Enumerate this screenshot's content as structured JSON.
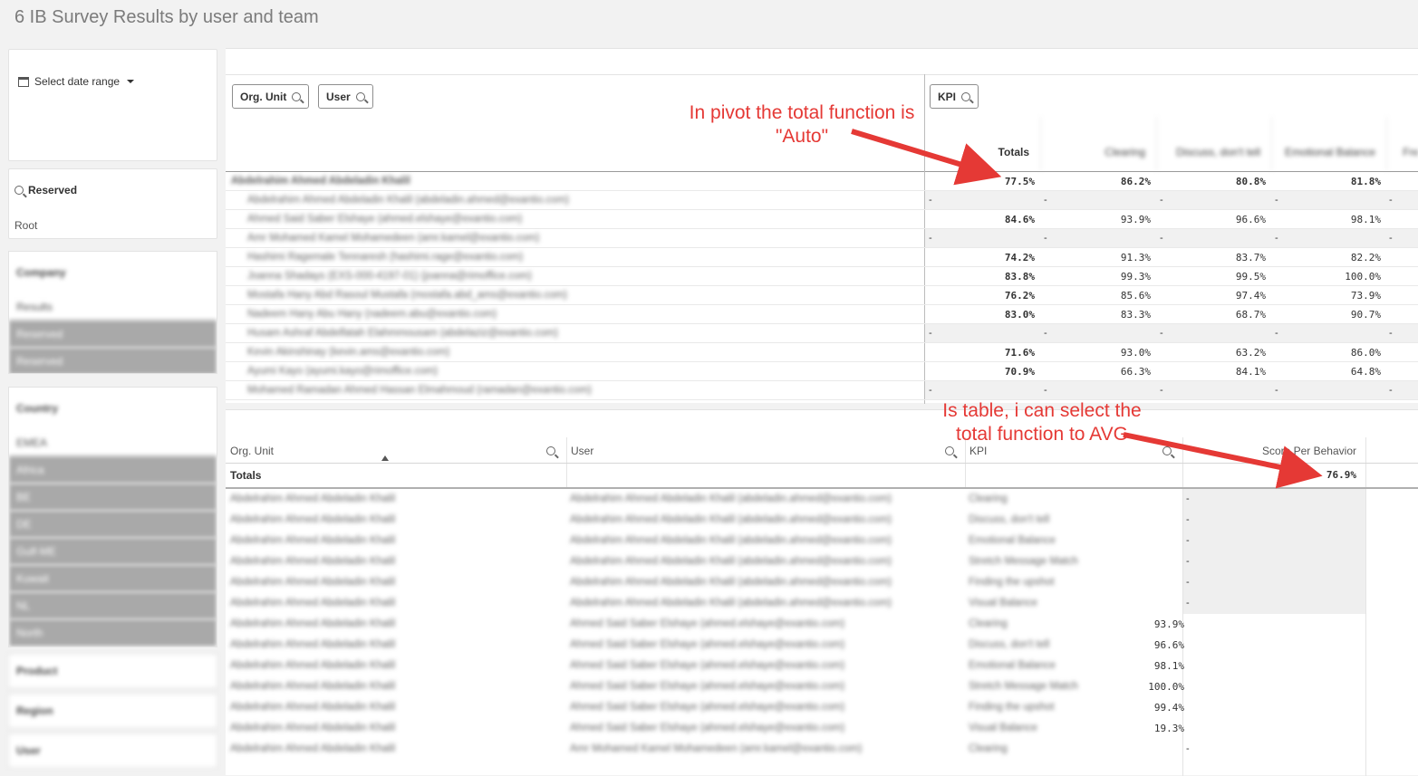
{
  "page": {
    "title": "6 IB Survey Results by user and team"
  },
  "date_filter": {
    "label": "Select date range"
  },
  "reserved": {
    "title": "Reserved",
    "value": "Root"
  },
  "lists": {
    "company": {
      "title": "Company",
      "items": [
        "Results",
        "Reserved",
        "Reserved"
      ]
    },
    "country": {
      "title": "Country",
      "items": [
        "EMEA",
        "Africa",
        "BE",
        "DE",
        "Gulf-ME",
        "Kuwait",
        "NL",
        "North"
      ]
    },
    "product": "Product",
    "region": "Region",
    "user": "User"
  },
  "pivot": {
    "dims": [
      "Org. Unit",
      "User"
    ],
    "col_dim": "KPI",
    "headers": [
      "Totals",
      "Clearing",
      "Discuss, don't tell",
      "Emotional Balance",
      "Frequency"
    ],
    "parent_name": "Abdelrahim Ahmed Abdeladin Khalil",
    "rows": [
      {
        "name": "Abdelrahim Ahmed Abdeladin Khalil",
        "vals": [
          "77.5%",
          "86.2%",
          "80.8%",
          "81.8%"
        ],
        "bold": true
      },
      {
        "name": "Abdelrahim Ahmed Abdeladin Khalil (abdeladin.ahmed@exantio.com)",
        "vals": [
          "-",
          "-",
          "-",
          "-"
        ]
      },
      {
        "name": "Ahmed Said Saber Elshaye (ahmed.elshaye@exantio.com)",
        "vals": [
          "84.6%",
          "93.9%",
          "96.6%",
          "98.1%"
        ]
      },
      {
        "name": "Amr Mohamed Kamel Mohamedeen (amr.kamel@exantio.com)",
        "vals": [
          "-",
          "-",
          "-",
          "-"
        ]
      },
      {
        "name": "Hashimi Ragemale Tennaresh (hashimi.rage@exantio.com)",
        "vals": [
          "74.2%",
          "91.3%",
          "83.7%",
          "82.2%"
        ]
      },
      {
        "name": "Joanna Shadays (EXS-000-4197-01) (joanna@rimoffice.com)",
        "vals": [
          "83.8%",
          "99.3%",
          "99.5%",
          "100.0%"
        ]
      },
      {
        "name": "Mostafa Hany Abd Rasoul Mustafa (mostafa.abd_ams@exantio.com)",
        "vals": [
          "76.2%",
          "85.6%",
          "97.4%",
          "73.9%"
        ]
      },
      {
        "name": "Nadeem Hany Abu Hany (nadeem.abu@exantio.com)",
        "vals": [
          "83.0%",
          "83.3%",
          "68.7%",
          "90.7%"
        ]
      },
      {
        "name": "Husam Ashraf Abdelfatah Elahmmousam (abdelaziz@exantio.com)",
        "vals": [
          "-",
          "-",
          "-",
          "-"
        ]
      },
      {
        "name": "Kevin Akinshinay (kevin.ams@exantio.com)",
        "vals": [
          "71.6%",
          "93.0%",
          "63.2%",
          "86.0%"
        ]
      },
      {
        "name": "Ayumi Kayo (ayumi.kayo@rimoffice.com)",
        "vals": [
          "70.9%",
          "66.3%",
          "84.1%",
          "64.8%"
        ]
      },
      {
        "name": "Mohamed Ramadan Ahmed Hassan Elmahmoud (ramadan@exantio.com)",
        "vals": [
          "-",
          "-",
          "-",
          "-"
        ]
      }
    ]
  },
  "table": {
    "headers": [
      "Org. Unit",
      "User",
      "KPI",
      "Score Per Behavior"
    ],
    "totals_label": "Totals",
    "totals_value": "76.9%",
    "rows": [
      {
        "org": "Abdelrahim Ahmed Abdeladin Khalil",
        "user": "Abdelrahim Ahmed Abdeladin Khalil (abdeladin.ahmed@exantio.com)",
        "kpi": "Clearing",
        "score": "-"
      },
      {
        "org": "Abdelrahim Ahmed Abdeladin Khalil",
        "user": "Abdelrahim Ahmed Abdeladin Khalil (abdeladin.ahmed@exantio.com)",
        "kpi": "Discuss, don't tell",
        "score": "-"
      },
      {
        "org": "Abdelrahim Ahmed Abdeladin Khalil",
        "user": "Abdelrahim Ahmed Abdeladin Khalil (abdeladin.ahmed@exantio.com)",
        "kpi": "Emotional Balance",
        "score": "-"
      },
      {
        "org": "Abdelrahim Ahmed Abdeladin Khalil",
        "user": "Abdelrahim Ahmed Abdeladin Khalil (abdeladin.ahmed@exantio.com)",
        "kpi": "Stretch Message Match",
        "score": "-"
      },
      {
        "org": "Abdelrahim Ahmed Abdeladin Khalil",
        "user": "Abdelrahim Ahmed Abdeladin Khalil (abdeladin.ahmed@exantio.com)",
        "kpi": "Finding the upshot",
        "score": "-"
      },
      {
        "org": "Abdelrahim Ahmed Abdeladin Khalil",
        "user": "Abdelrahim Ahmed Abdeladin Khalil (abdeladin.ahmed@exantio.com)",
        "kpi": "Visual Balance",
        "score": "-"
      },
      {
        "org": "Abdelrahim Ahmed Abdeladin Khalil",
        "user": "Ahmed Said Saber Elshaye (ahmed.elshaye@exantio.com)",
        "kpi": "Clearing",
        "score": "93.9%"
      },
      {
        "org": "Abdelrahim Ahmed Abdeladin Khalil",
        "user": "Ahmed Said Saber Elshaye (ahmed.elshaye@exantio.com)",
        "kpi": "Discuss, don't tell",
        "score": "96.6%"
      },
      {
        "org": "Abdelrahim Ahmed Abdeladin Khalil",
        "user": "Ahmed Said Saber Elshaye (ahmed.elshaye@exantio.com)",
        "kpi": "Emotional Balance",
        "score": "98.1%"
      },
      {
        "org": "Abdelrahim Ahmed Abdeladin Khalil",
        "user": "Ahmed Said Saber Elshaye (ahmed.elshaye@exantio.com)",
        "kpi": "Stretch Message Match",
        "score": "100.0%"
      },
      {
        "org": "Abdelrahim Ahmed Abdeladin Khalil",
        "user": "Ahmed Said Saber Elshaye (ahmed.elshaye@exantio.com)",
        "kpi": "Finding the upshot",
        "score": "99.4%"
      },
      {
        "org": "Abdelrahim Ahmed Abdeladin Khalil",
        "user": "Ahmed Said Saber Elshaye (ahmed.elshaye@exantio.com)",
        "kpi": "Visual Balance",
        "score": "19.3%"
      },
      {
        "org": "Abdelrahim Ahmed Abdeladin Khalil",
        "user": "Amr Mohamed Kamel Mohamedeen (amr.kamel@exantio.com)",
        "kpi": "Clearing",
        "score": "-"
      }
    ]
  },
  "annotations": {
    "pivot": "In pivot the total function is \"Auto\"",
    "table": "Is table, i can select the total function to AVG"
  },
  "colors": {
    "annotation": "#e53935",
    "arrow": "#e53935"
  }
}
